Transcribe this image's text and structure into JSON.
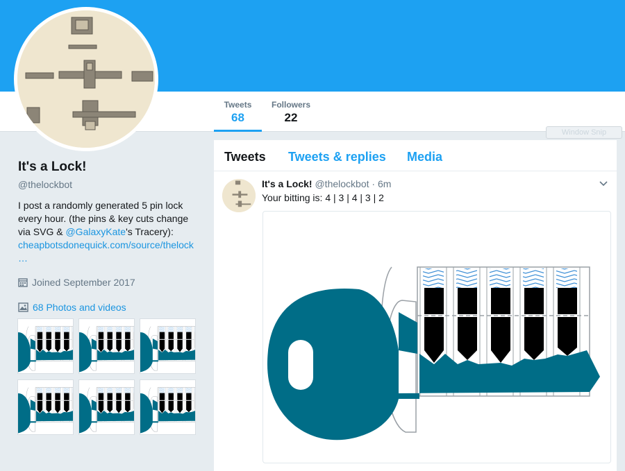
{
  "nav": {
    "stats": [
      {
        "label": "Tweets",
        "value": "68"
      },
      {
        "label": "Followers",
        "value": "22"
      }
    ],
    "ghost_button": "Window Snip"
  },
  "profile": {
    "name": "It's a Lock!",
    "handle": "@thelockbot",
    "bio_part1": "I post a randomly generated 5 pin lock every hour. (the pins & key cuts change via SVG & ",
    "bio_mention": "@GalaxyKate",
    "bio_part2": "'s Tracery):",
    "bio_link": "cheapbotsdonequick.com/source/thelock",
    "bio_ellipsis": "…",
    "joined": "Joined September 2017",
    "photos_link": "68 Photos and videos"
  },
  "timeline": {
    "tabs": [
      "Tweets",
      "Tweets & replies",
      "Media"
    ],
    "tweet": {
      "name": "It's a Lock!",
      "handle": "@thelockbot",
      "separator": "·",
      "time": "6m",
      "text": "Your bitting is: 4 | 3 | 4 | 3 | 2"
    }
  },
  "icons": {
    "calendar": "calendar-icon",
    "photo": "photo-icon",
    "caret": "chevron-down-icon"
  },
  "colors": {
    "header_blue": "#1da1f2",
    "link_blue": "#1b95e0",
    "key_teal": "#006d87",
    "spring_blue": "#3d8fd6",
    "background": "#e6ecf0"
  }
}
